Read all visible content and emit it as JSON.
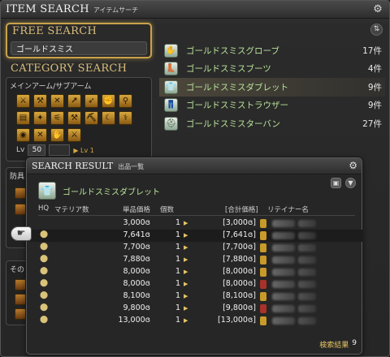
{
  "window": {
    "title": "ITEM SEARCH",
    "subtitle": "アイテムサーチ",
    "gear_icon": "gear-icon"
  },
  "free_search": {
    "title": "FREE SEARCH",
    "query": "ゴールドスミス"
  },
  "category_search": {
    "title": "CATEGORY SEARCH",
    "main_sub_label": "メインアーム/サブアーム",
    "icon_rows": [
      [
        "sword-icon",
        "axe-icon",
        "crossed-icon",
        "lance-icon",
        "bow-icon",
        "fist-icon",
        "staff-icon"
      ],
      [
        "book-icon",
        "wand-icon",
        "saw-icon",
        "hammer-icon",
        "pick-icon",
        "sickle-icon",
        "needle-icon"
      ],
      [
        "cauldron-icon",
        "crossed-icon",
        "glove-icon",
        "blade-icon"
      ]
    ],
    "level_label": "Lv",
    "level_min": "50",
    "level_max": "",
    "level_arrow_label": "▶ Lv 1"
  },
  "armor_panel": {
    "label": "防具"
  },
  "other_panel": {
    "label": "その"
  },
  "results": {
    "sort_icon": "sort-icon",
    "items": [
      {
        "name": "ゴールドスミスグローブ",
        "count": "17件",
        "icon": "glove-icon",
        "glyph": "✋",
        "selected": false
      },
      {
        "name": "ゴールドスミスブーツ",
        "count": "4件",
        "icon": "boots-icon",
        "glyph": "👢",
        "selected": false
      },
      {
        "name": "ゴールドスミスダブレット",
        "count": "9件",
        "icon": "doublet-icon",
        "glyph": "👕",
        "selected": true
      },
      {
        "name": "ゴールドスミストラウザー",
        "count": "9件",
        "icon": "trousers-icon",
        "glyph": "👖",
        "selected": false
      },
      {
        "name": "ゴールドスミスターバン",
        "count": "27件",
        "icon": "turban-icon",
        "glyph": "⛑",
        "selected": false
      }
    ]
  },
  "search_result": {
    "title": "SEARCH RESULT",
    "subtitle": "出品一覧",
    "item_name": "ゴールドスミスダブレット",
    "columns": {
      "hq": "HQ",
      "materia": "マテリア数",
      "unit_price": "単品価格",
      "quantity": "個数",
      "total": "[合計価格]",
      "retainer": "リテイナー名"
    },
    "rows": [
      {
        "hq": "",
        "price": "3,000",
        "qty": "1",
        "total": "[3,000",
        "badge": "gold"
      },
      {
        "hq": "⬤",
        "price": "7,641",
        "qty": "1",
        "total": "[7,641",
        "badge": "gold"
      },
      {
        "hq": "⬤",
        "price": "7,700",
        "qty": "1",
        "total": "[7,700",
        "badge": "gold"
      },
      {
        "hq": "⬤",
        "price": "7,880",
        "qty": "1",
        "total": "[7,880",
        "badge": "gold"
      },
      {
        "hq": "⬤",
        "price": "8,000",
        "qty": "1",
        "total": "[8,000",
        "badge": "gold"
      },
      {
        "hq": "⬤",
        "price": "8,000",
        "qty": "1",
        "total": "[8,000",
        "badge": "red"
      },
      {
        "hq": "⬤",
        "price": "8,100",
        "qty": "1",
        "total": "[8,100",
        "badge": "gold"
      },
      {
        "hq": "⬤",
        "price": "9,800",
        "qty": "1",
        "total": "[9,800",
        "badge": "red"
      },
      {
        "hq": "⬤",
        "price": "13,000",
        "qty": "1",
        "total": "[13,000",
        "badge": "gold"
      }
    ],
    "gil_mark": "ɞ",
    "footer_label": "検索結果",
    "footer_count": "9"
  },
  "colors": {
    "accent_gold": "#d9bf7c",
    "item_green": "#b8e39a",
    "badge_gold": "#c79a2a",
    "badge_red": "#a8322a"
  }
}
